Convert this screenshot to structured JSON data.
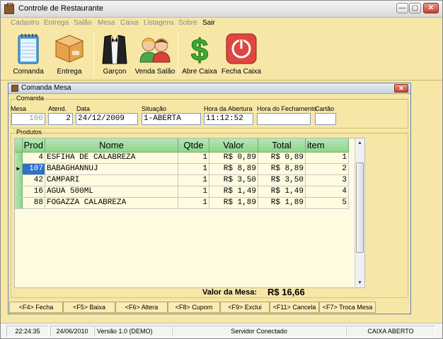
{
  "window": {
    "title": "Controle de Restaurante",
    "btn_min": "—",
    "btn_max": "▢",
    "btn_close": "✕"
  },
  "menu": [
    "Cadastro",
    "Entrega",
    "Salão",
    "Mesa",
    "Caixa",
    "Listagens",
    "Sobre",
    "Sair"
  ],
  "toolbar": [
    {
      "label": "Comanda",
      "icon": "notepad-icon"
    },
    {
      "label": "Entrega",
      "icon": "delivery-box-icon"
    },
    {
      "label": "Garçon",
      "icon": "waiter-tuxedo-icon"
    },
    {
      "label": "Venda Salão",
      "icon": "people-icon"
    },
    {
      "label": "Abre Caixa",
      "icon": "dollar-icon"
    },
    {
      "label": "Fecha Caixa",
      "icon": "power-icon"
    }
  ],
  "child": {
    "title": "Comanda Mesa",
    "close": "✕",
    "comanda_group": "Comanda",
    "fields": {
      "mesa_label": "Mesa",
      "mesa": "100",
      "atend_label": "Atend.",
      "atend": "2",
      "data_label": "Data",
      "data": "24/12/2009",
      "situacao_label": "Situação",
      "situacao": "1-ABERTA",
      "abertura_label": "Hora da Abertura",
      "abertura": "11:12:52",
      "fechamento_label": "Hora do Fechamento",
      "fechamento": "",
      "cartao_label": "Cartão",
      "cartao": ""
    },
    "produtos_group": "Produtos",
    "columns": [
      "Prod",
      "Nome",
      "Qtde",
      "Valor",
      "Total",
      "item"
    ],
    "rows": [
      {
        "prod": "4",
        "nome": "ESFIHA DE CALABREZA",
        "qtde": "1",
        "valor": "R$ 0,89",
        "total": "R$ 0,89",
        "item": "1"
      },
      {
        "prod": "107",
        "nome": "BABAGHANNUJ",
        "qtde": "1",
        "valor": "R$ 8,89",
        "total": "R$ 8,89",
        "item": "2"
      },
      {
        "prod": "42",
        "nome": "CAMPARI",
        "qtde": "1",
        "valor": "R$ 3,50",
        "total": "R$ 3,50",
        "item": "3"
      },
      {
        "prod": "16",
        "nome": "AGUA 500ML",
        "qtde": "1",
        "valor": "R$ 1,49",
        "total": "R$ 1,49",
        "item": "4"
      },
      {
        "prod": "88",
        "nome": "FOGAZZA CALABREZA",
        "qtde": "1",
        "valor": "R$ 1,89",
        "total": "R$ 1,89",
        "item": "5"
      }
    ],
    "current_row_marker": "▶",
    "total_label": "Valor da Mesa:",
    "total_value": "R$ 16,66",
    "fkeys": [
      "<F4> Fecha",
      "<F5> Baixa",
      "<F6> Altera",
      "<F8> Cupom",
      "<F9> Exclui",
      "<F11> Cancela",
      "<F7> Troca Mesa"
    ]
  },
  "status": {
    "time": "22:24:35",
    "date": "24/06/2010",
    "version": "Versão 1.0 (DEMO)",
    "server": "Servidor Conectado",
    "caixa": "CAIXA ABERTO"
  },
  "colors": {
    "background": "#f7e7a6",
    "grid_header": "#8fd58b",
    "selection": "#2f6ec9",
    "close_red": "#c7422a"
  }
}
